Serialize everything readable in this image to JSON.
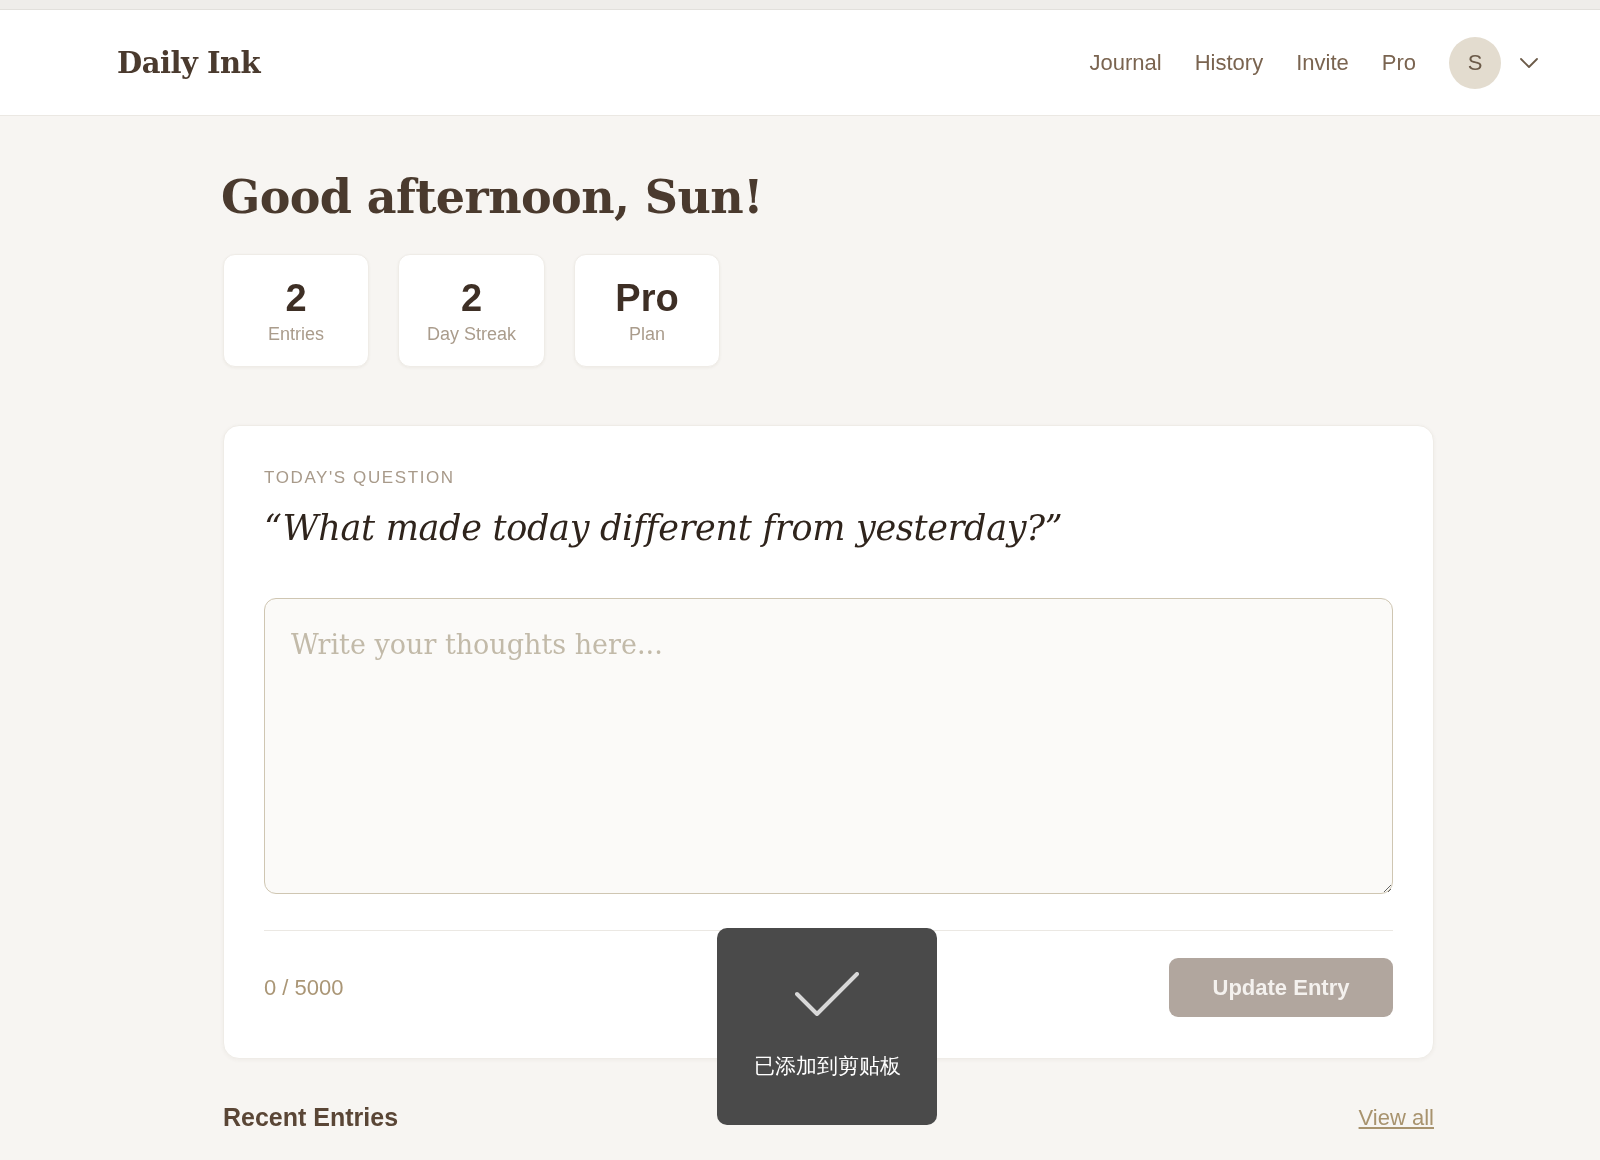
{
  "header": {
    "logo": "Daily Ink",
    "nav": [
      {
        "label": "Journal"
      },
      {
        "label": "History"
      },
      {
        "label": "Invite"
      },
      {
        "label": "Pro"
      }
    ],
    "avatar": {
      "initial": "S"
    }
  },
  "greeting": "Good afternoon, Sun!",
  "stats": [
    {
      "value": "2",
      "label": "Entries"
    },
    {
      "value": "2",
      "label": "Day Streak"
    },
    {
      "value": "Pro",
      "label": "Plan"
    }
  ],
  "question_card": {
    "label": "TODAY'S QUESTION",
    "question": "“What made today different from yesterday?”",
    "entry": {
      "placeholder": "Write your thoughts here..."
    },
    "counter": "0 / 5000",
    "submit": {
      "label": "Update Entry",
      "disabled": true
    }
  },
  "recent_entries": {
    "title": "Recent Entries",
    "link": "View all"
  },
  "toast": {
    "message": "已添加到剪贴板"
  }
}
